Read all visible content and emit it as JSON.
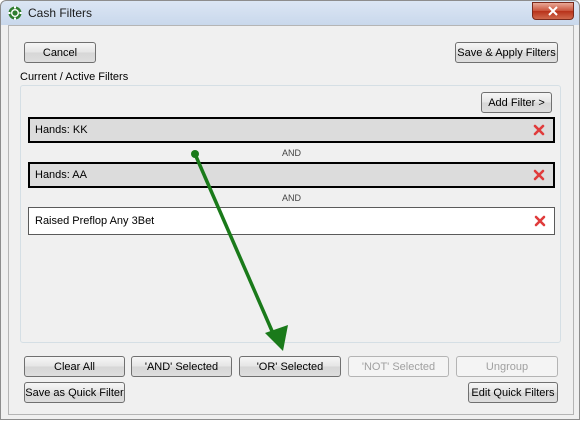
{
  "window": {
    "title": "Cash Filters",
    "close_icon": "close-icon"
  },
  "toolbar": {
    "cancel_label": "Cancel",
    "save_apply_label": "Save & Apply Filters"
  },
  "filters_group": {
    "label": "Current / Active Filters",
    "add_filter_label": "Add Filter >",
    "items": [
      {
        "text": "Hands: KK",
        "selected": true
      },
      {
        "text": "Hands: AA",
        "selected": true
      },
      {
        "text": "Raised Preflop Any 3Bet",
        "selected": false
      }
    ],
    "connectors": [
      "AND",
      "AND"
    ]
  },
  "actions": {
    "clear_all": "Clear All",
    "and_selected": "'AND' Selected",
    "or_selected": "'OR' Selected",
    "not_selected": "'NOT' Selected",
    "ungroup": "Ungroup"
  },
  "footer": {
    "save_quick": "Save as Quick Filter",
    "edit_quick": "Edit Quick Filters"
  },
  "colors": {
    "remove_icon": "#e03b3b",
    "arrow": "#1a7a1a",
    "title_bar": "#c9d8ec"
  }
}
